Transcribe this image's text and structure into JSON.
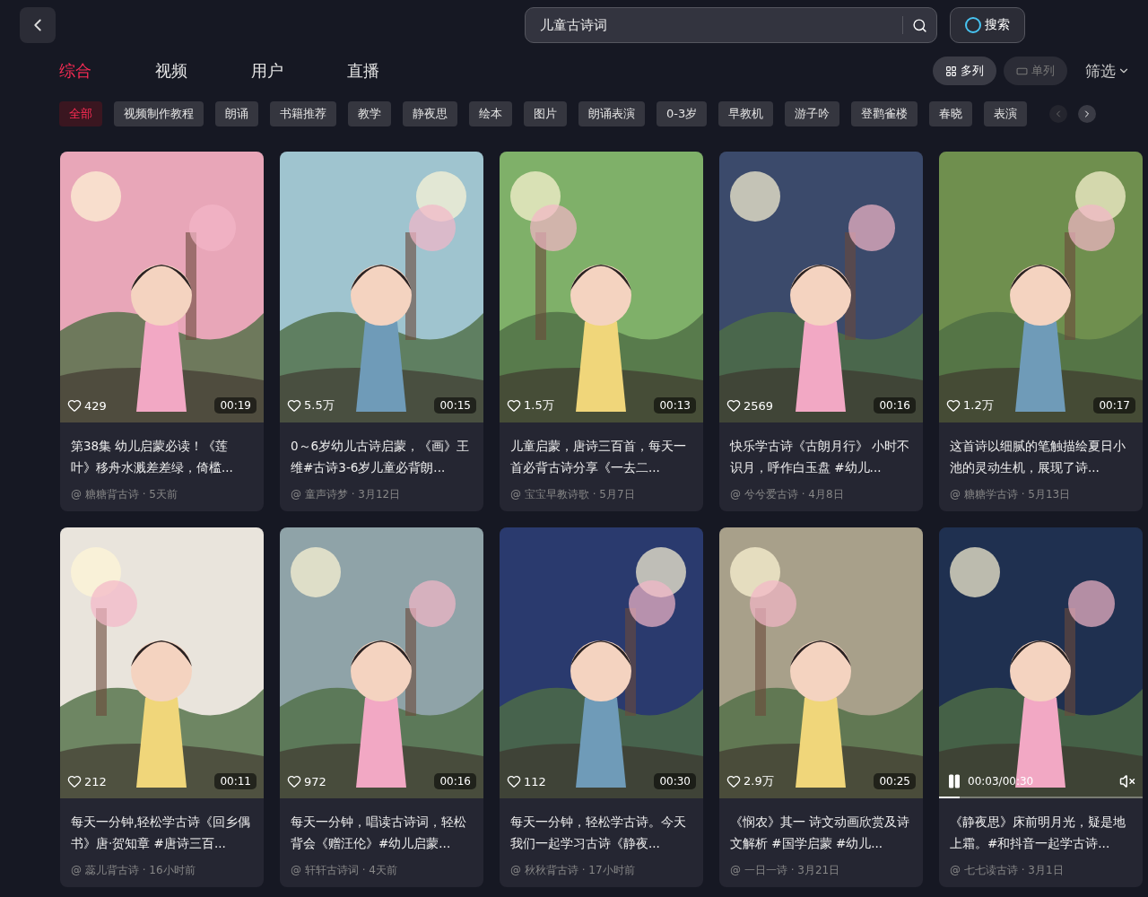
{
  "search": {
    "value": "儿童古诗词",
    "ai_button": "搜索"
  },
  "tabs": [
    {
      "label": "综合",
      "selected": true
    },
    {
      "label": "视频",
      "selected": false
    },
    {
      "label": "用户",
      "selected": false
    },
    {
      "label": "直播",
      "selected": false
    }
  ],
  "layout_toggle": [
    {
      "label": "多列",
      "selected": true
    },
    {
      "label": "单列",
      "selected": false
    }
  ],
  "filter": "筛选",
  "tags": [
    {
      "label": "全部",
      "selected": true
    },
    {
      "label": "视频制作教程",
      "selected": false
    },
    {
      "label": "朗诵",
      "selected": false
    },
    {
      "label": "书籍推荐",
      "selected": false
    },
    {
      "label": "教学",
      "selected": false
    },
    {
      "label": "静夜思",
      "selected": false
    },
    {
      "label": "绘本",
      "selected": false
    },
    {
      "label": "图片",
      "selected": false
    },
    {
      "label": "朗诵表演",
      "selected": false
    },
    {
      "label": "0-3岁",
      "selected": false
    },
    {
      "label": "早教机",
      "selected": false
    },
    {
      "label": "游子吟",
      "selected": false
    },
    {
      "label": "登鹳雀楼",
      "selected": false
    },
    {
      "label": "春晓",
      "selected": false
    },
    {
      "label": "表演",
      "selected": false
    }
  ],
  "videos": [
    {
      "kind": "video",
      "likes": "429",
      "duration": "00:19",
      "title": "第38集 幼儿启蒙必读！《莲叶》移舟水溅差差绿，倚槛...",
      "author": "@ 糖糖背古诗",
      "time": "· 5天前"
    },
    {
      "kind": "video",
      "likes": "5.5万",
      "duration": "00:15",
      "title": "0～6岁幼儿古诗启蒙，《画》王维#古诗3-6岁儿童必背朗...",
      "author": "@ 童声诗梦",
      "time": "· 3月12日"
    },
    {
      "kind": "video",
      "likes": "1.5万",
      "duration": "00:13",
      "title": "儿童启蒙，唐诗三百首，每天一首必背古诗分享《一去二...",
      "author": "@ 宝宝早教诗歌",
      "time": "· 5月7日"
    },
    {
      "kind": "video",
      "likes": "2569",
      "duration": "00:16",
      "title": "快乐学古诗《古朗月行》 小时不识月，呼作白玉盘 #幼儿...",
      "author": "@ 兮兮爱古诗",
      "time": "· 4月8日"
    },
    {
      "kind": "video",
      "likes": "1.2万",
      "duration": "00:17",
      "title": "这首诗以细腻的笔触描绘夏日小池的灵动生机，展现了诗...",
      "author": "@ 糖糖学古诗",
      "time": "· 5月13日"
    },
    {
      "kind": "video",
      "likes": "212",
      "duration": "00:11",
      "title": "每天一分钟,轻松学古诗《回乡偶书》唐·贺知章 #唐诗三百...",
      "author": "@ 蕊儿背古诗",
      "time": "· 16小时前"
    },
    {
      "kind": "video",
      "likes": "972",
      "duration": "00:16",
      "title": "每天一分钟，唱读古诗词，轻松背会《赠汪伦》#幼儿启蒙...",
      "author": "@ 轩轩古诗词",
      "time": "· 4天前"
    },
    {
      "kind": "video",
      "likes": "112",
      "duration": "00:30",
      "title": "每天一分钟，轻松学古诗。今天我们一起学习古诗《静夜...",
      "author": "@ 秋秋背古诗",
      "time": "· 17小时前"
    },
    {
      "kind": "video",
      "likes": "2.9万",
      "duration": "00:25",
      "title": "《悯农》其一 诗文动画欣赏及诗文解析 #国学启蒙 #幼儿...",
      "author": "@ 一日一诗",
      "time": "· 3月21日"
    },
    {
      "kind": "playing",
      "progress": "00:03/00:30",
      "level": 0.1,
      "title": "《静夜思》床前明月光，疑是地上霜。#和抖音一起学古诗...",
      "author": "@ 七七读古诗",
      "time": "· 3月1日"
    }
  ]
}
